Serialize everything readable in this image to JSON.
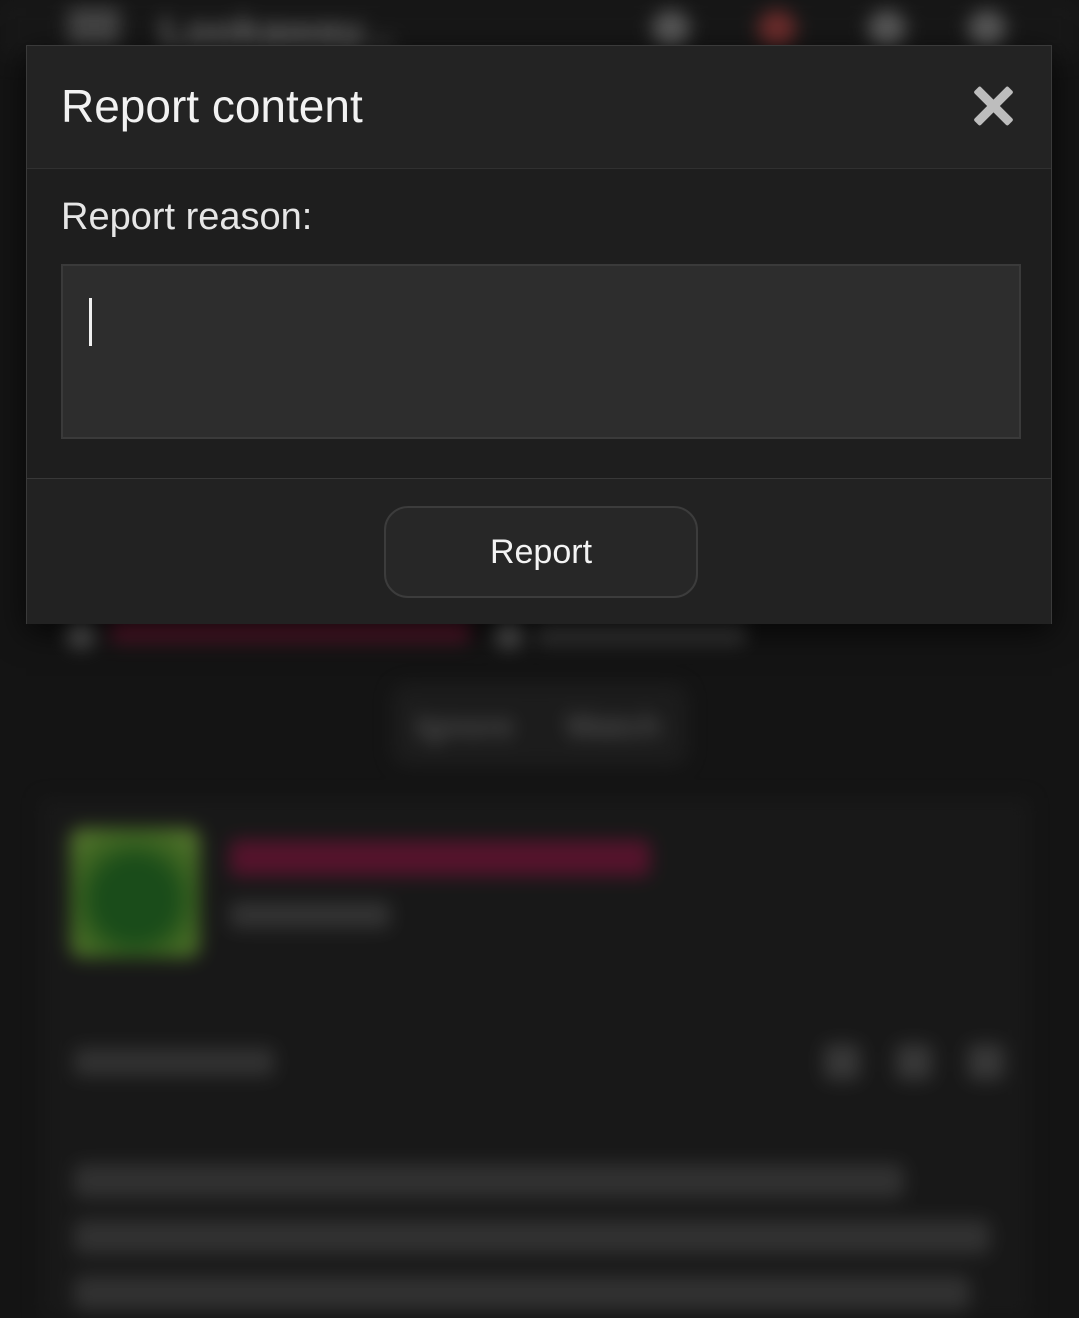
{
  "background": {
    "site_title": "Lookaway...",
    "actions": {
      "ignore_label": "Ignore",
      "watch_label": "Watch"
    },
    "post": {
      "time_ago": "3 minutes ago",
      "author_title": "xydhb bhbu"
    }
  },
  "modal": {
    "title": "Report content",
    "close_icon": "close-icon",
    "reason_label": "Report reason:",
    "reason_value": "",
    "submit_label": "Report"
  },
  "colors": {
    "modal_background": "#1e1e1e",
    "header_background": "#232323",
    "textarea_background": "#2d2d2d",
    "author_link": "#8a1340"
  }
}
